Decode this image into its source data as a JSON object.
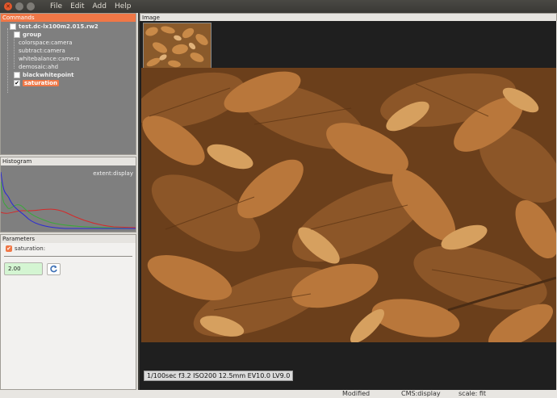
{
  "window": {
    "menu": [
      "File",
      "Edit",
      "Add",
      "Help"
    ]
  },
  "commands": {
    "title": "Commands",
    "items": [
      {
        "label": "test.dc-lx100m2.015.rw2",
        "checked": false,
        "bold": true,
        "depth": 0
      },
      {
        "label": "group",
        "checked": false,
        "bold": true,
        "depth": 1
      },
      {
        "label": "colorspace:camera",
        "depth": 2
      },
      {
        "label": "subtract:camera",
        "depth": 2
      },
      {
        "label": "whitebalance:camera",
        "depth": 2
      },
      {
        "label": "demosaic:ahd",
        "depth": 2
      },
      {
        "label": "blackwhitepoint",
        "checked": false,
        "bold": true,
        "depth": 1
      },
      {
        "label": "saturation",
        "checked": true,
        "bold": true,
        "depth": 1,
        "selected": true
      }
    ]
  },
  "histogram": {
    "title": "Histogram",
    "label": "extent:display",
    "colors": {
      "red": "#d42a2a",
      "green": "#3aa83a",
      "blue": "#2a2ad4"
    }
  },
  "parameters": {
    "title": "Parameters",
    "saturation_label": "saturation:",
    "saturation_value": "2.00"
  },
  "image_panel": {
    "title": "Image",
    "exif": "1/100sec  f3.2  ISO200  12.5mm  EV10.0 LV9.0"
  },
  "status": {
    "modified": "Modified",
    "cms": "CMS:display",
    "scale": "scale: fit"
  },
  "colors": {
    "accent": "#f07746",
    "panel_bg": "#7f7f7f",
    "canvas_bg": "#1f1f1f"
  }
}
